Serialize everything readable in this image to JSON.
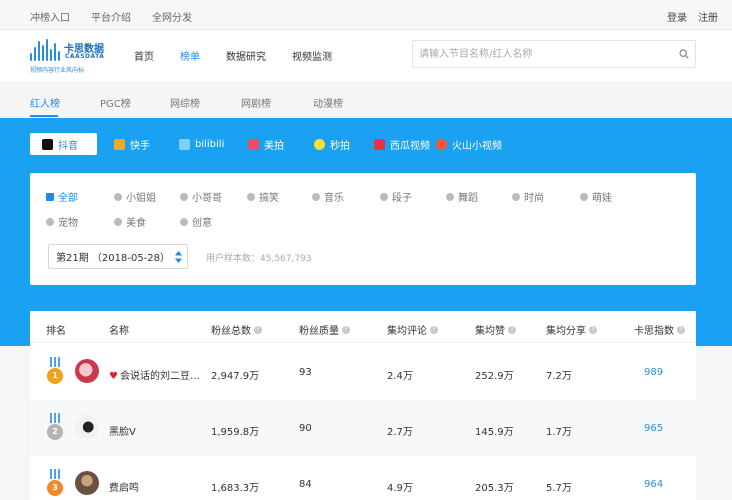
{
  "topbar": {
    "links": [
      "冲榜入口",
      "平台介绍",
      "全网分发"
    ],
    "login": "登录",
    "register": "注册"
  },
  "logo": {
    "name_cn": "卡思数据",
    "name_en": "CAASDATA",
    "tagline": "视频内容行业风向标"
  },
  "nav": {
    "items": [
      "首页",
      "榜单",
      "数据研究",
      "视频监测"
    ],
    "active_index": 1
  },
  "search": {
    "placeholder": "请输入节目名称/红人名称",
    "value": ""
  },
  "rank_tabs": {
    "items": [
      "红人榜",
      "PGC榜",
      "网综榜",
      "网剧榜",
      "动漫榜"
    ],
    "active_index": 0
  },
  "platforms": {
    "items": [
      "抖音",
      "快手",
      "bilibili",
      "美拍",
      "秒拍",
      "西瓜视频",
      "火山小视频"
    ],
    "active_index": 0
  },
  "categories": {
    "items": [
      "全部",
      "小姐姐",
      "小哥哥",
      "搞笑",
      "音乐",
      "段子",
      "舞蹈",
      "时尚",
      "萌娃",
      "宠物",
      "美食",
      "创意"
    ],
    "active_index": 0
  },
  "period": {
    "value": "第21期 （2018-05-28）"
  },
  "sample": {
    "label": "用户样本数：",
    "value": "45,567,793"
  },
  "table": {
    "headers": [
      "排名",
      "名称",
      "粉丝总数",
      "粉丝质量",
      "集均评论",
      "集均赞",
      "集均分享",
      "卡思指数"
    ],
    "rows": [
      {
        "rank": "1",
        "name": "会说话的刘二豆…",
        "fans": "2,947.9万",
        "quality": "93",
        "comments": "2.4万",
        "likes": "252.9万",
        "shares": "7.2万",
        "index": "989"
      },
      {
        "rank": "2",
        "name": "黑脸V",
        "fans": "1,959.8万",
        "quality": "90",
        "comments": "2.7万",
        "likes": "145.9万",
        "shares": "1.7万",
        "index": "965"
      },
      {
        "rank": "3",
        "name": "费启鸣",
        "fans": "1,683.3万",
        "quality": "84",
        "comments": "4.9万",
        "likes": "205.3万",
        "shares": "5.7万",
        "index": "964"
      }
    ]
  },
  "colors": {
    "accent": "#1a8cf0",
    "band": "#1ba1f2",
    "gold": "#f0a21a",
    "silver": "#b4b4b4",
    "bronze": "#f28a2a"
  }
}
